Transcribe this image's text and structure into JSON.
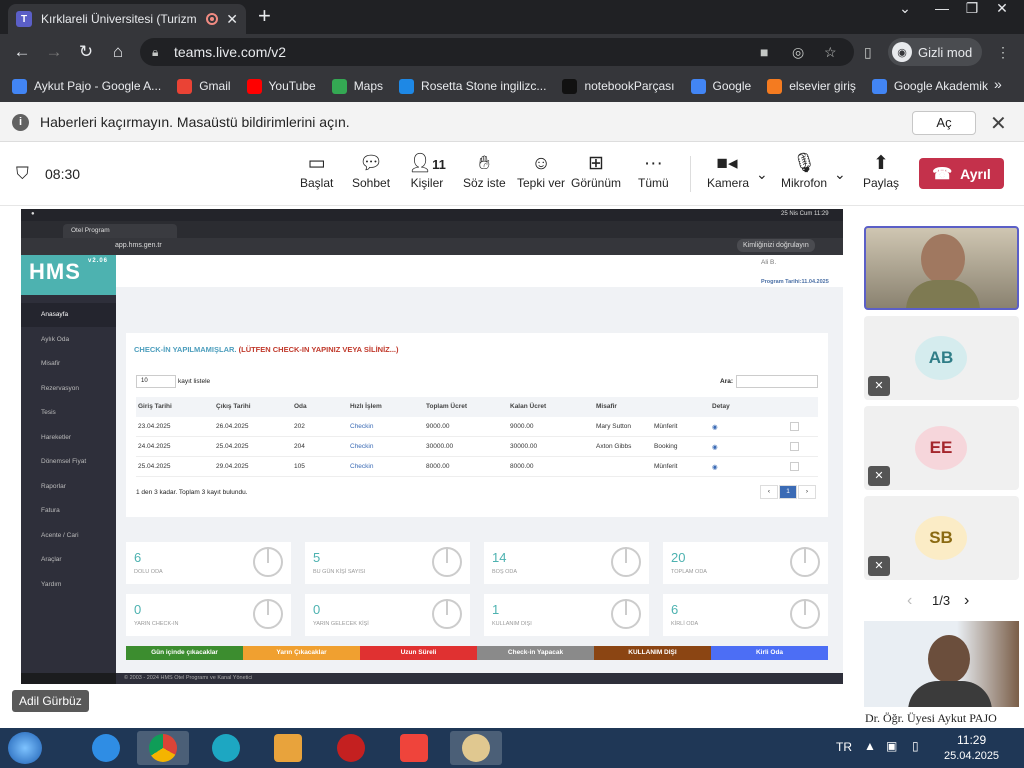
{
  "browser": {
    "tab_title": "Kırklareli Üniversitesi (Turizm Fak",
    "url": "teams.live.com/v2",
    "incognito_label": "Gizli mod",
    "bookmarks": [
      {
        "label": "Aykut Pajo - Google A...",
        "icon": "google-scholar-icon",
        "color": "#4285f4"
      },
      {
        "label": "Gmail",
        "icon": "gmail-icon",
        "color": "#ea4335"
      },
      {
        "label": "YouTube",
        "icon": "youtube-icon",
        "color": "#ff0000"
      },
      {
        "label": "Maps",
        "icon": "maps-icon",
        "color": "#34a853"
      },
      {
        "label": "Rosetta Stone ingilizc...",
        "icon": "rosetta-icon",
        "color": "#1e88e5"
      },
      {
        "label": "notebookParçası",
        "icon": "notebook-icon",
        "color": "#111111"
      },
      {
        "label": "Google",
        "icon": "google-icon",
        "color": "#4285f4"
      },
      {
        "label": "elsevier giriş",
        "icon": "elsevier-icon",
        "color": "#f47b20"
      },
      {
        "label": "Google Akademik",
        "icon": "google-scholar-icon",
        "color": "#4285f4"
      }
    ]
  },
  "notification": {
    "text": "Haberleri kaçırmayın. Masaüstü bildirimlerini açın.",
    "button": "Aç"
  },
  "meeting": {
    "time": "08:30",
    "controls": [
      {
        "label": "Başlat",
        "icon": "share-screen-icon"
      },
      {
        "label": "Sohbet",
        "icon": "chat-icon"
      },
      {
        "label": "Kişiler",
        "icon": "people-icon",
        "count": "11"
      },
      {
        "label": "Söz iste",
        "icon": "raise-hand-icon"
      },
      {
        "label": "Tepki ver",
        "icon": "emoji-icon"
      },
      {
        "label": "Görünüm",
        "icon": "layout-icon"
      },
      {
        "label": "Tümü",
        "icon": "more-icon"
      }
    ],
    "camera": "Kamera",
    "mic": "Mikrofon",
    "share": "Paylaş",
    "leave": "Ayrıl"
  },
  "shared_screen": {
    "presenter": "Adil Gürbüz",
    "mac_time": "25 Nis Cum  11:29",
    "inner_tab": "Otel Program",
    "inner_url": "app.hms.gen.tr",
    "verify": "Kimliğinizi doğrulayın",
    "logo": "HMS",
    "version": "v2.06",
    "user": "Ali B.",
    "program_date": "Program Tarihi:11.04.2025",
    "sidebar": [
      "Anasayfa",
      "Aylık Oda",
      "Misafir",
      "Rezervasyon",
      "Tesis",
      "Hareketler",
      "Dönemsel Fiyat",
      "Raporlar",
      "Fatura",
      "Acente / Cari",
      "Araçlar",
      "Yardım"
    ],
    "panel_title": "CHECK-İN YAPILMAMIŞLAR.",
    "panel_warning": "(LÜTFEN CHECK-IN YAPINIZ VEYA SİLİNİZ...)",
    "page_size": "10",
    "page_size_label": "kayıt listele",
    "search_label": "Ara:",
    "columns": [
      "Giriş Tarihi",
      "Çıkış Tarihi",
      "Oda",
      "Hızlı İşlem",
      "Toplam Ücret",
      "Kalan Ücret",
      "Misafir",
      "",
      "Detay"
    ],
    "rows": [
      [
        "23.04.2025",
        "26.04.2025",
        "202",
        "Checkin",
        "9000.00",
        "9000.00",
        "Mary Sutton",
        "Münferit"
      ],
      [
        "24.04.2025",
        "25.04.2025",
        "204",
        "Checkin",
        "30000.00",
        "30000.00",
        "Axton Gibbs",
        "Booking"
      ],
      [
        "25.04.2025",
        "29.04.2025",
        "105",
        "Checkin",
        "8000.00",
        "8000.00",
        "",
        "Münferit"
      ]
    ],
    "summary": "1 den 3 kadar. Toplam 3 kayıt bulundu.",
    "pager": [
      "‹",
      "1",
      "›"
    ],
    "stats": [
      {
        "value": "6",
        "label": "DOLU ODA"
      },
      {
        "value": "5",
        "label": "BU GÜN KİŞİ SAYISI"
      },
      {
        "value": "14",
        "label": "BOŞ ODA"
      },
      {
        "value": "20",
        "label": "TOPLAM ODA"
      },
      {
        "value": "0",
        "label": "YARIN CHECK-IN"
      },
      {
        "value": "0",
        "label": "YARIN GELECEK KİŞİ"
      },
      {
        "value": "1",
        "label": "KULLANIM DIŞI"
      },
      {
        "value": "6",
        "label": "KİRLİ ODA"
      }
    ],
    "legend": [
      {
        "label": "Gün içinde çıkacaklar",
        "color": "#3c8d2f"
      },
      {
        "label": "Yarın Çıkacaklar",
        "color": "#f0a030"
      },
      {
        "label": "Uzun Süreli",
        "color": "#e03131"
      },
      {
        "label": "Check-in Yapacak",
        "color": "#8a8a8a"
      },
      {
        "label": "KULLANIM DIŞI",
        "color": "#8b4513"
      },
      {
        "label": "Kirli Oda",
        "color": "#4c6ef5"
      }
    ],
    "footer": "© 2003 - 2024 HMS Otel Programı ve Kanal Yönetici"
  },
  "participants": [
    {
      "initials": "AB",
      "bg": "#d5ecee",
      "fg": "#2f7d87"
    },
    {
      "initials": "EE",
      "bg": "#f6d6db",
      "fg": "#a4262c"
    },
    {
      "initials": "SB",
      "bg": "#fbecc6",
      "fg": "#8a6a12"
    }
  ],
  "pagination": "1/3",
  "host_name": "Dr. Öğr. Üyesi Aykut PAJO",
  "taskbar": {
    "lang": "TR",
    "time": "11:29",
    "date": "25.04.2025"
  }
}
